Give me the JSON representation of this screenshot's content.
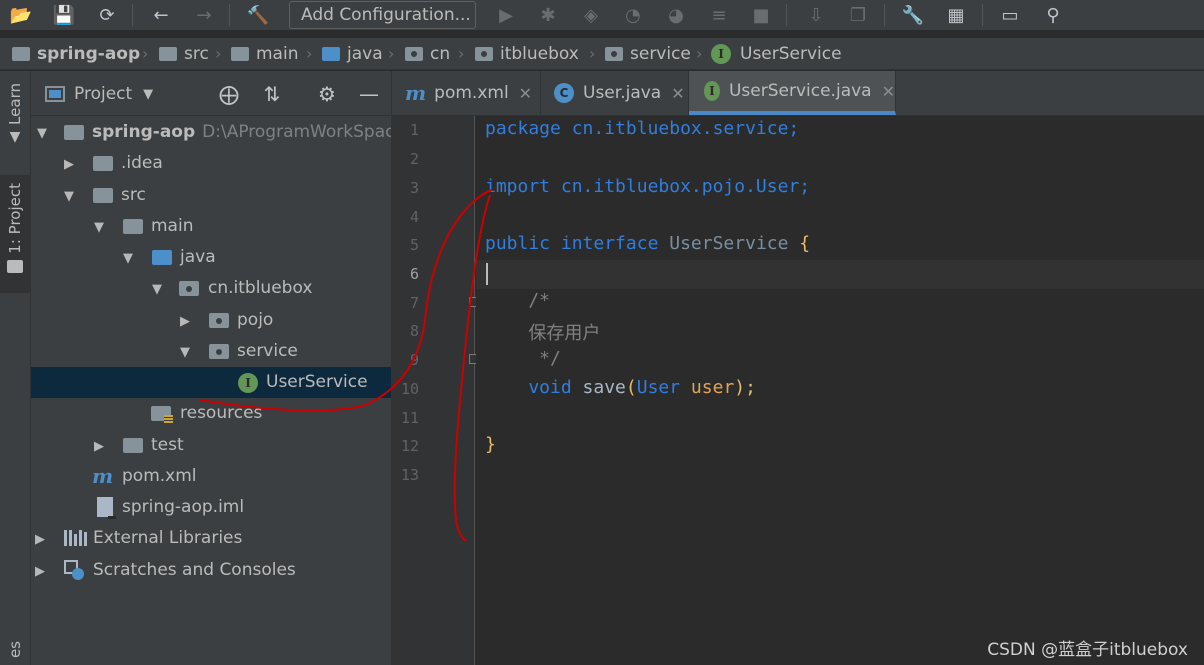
{
  "toolbar": {
    "run_config": "Add Configuration..."
  },
  "breadcrumb": [
    "spring-aop",
    "src",
    "main",
    "java",
    "cn",
    "itbluebox",
    "service",
    "UserService"
  ],
  "stripe": {
    "learn": "Learn",
    "project": "1: Project",
    "bottom": "es"
  },
  "project_panel": {
    "title": "Project"
  },
  "tree": {
    "root": "spring-aop",
    "root_path": "D:\\AProgramWorkSpace",
    "idea": ".idea",
    "src": "src",
    "main": "main",
    "java": "java",
    "package": "cn.itbluebox",
    "pojo": "pojo",
    "service": "service",
    "userservice": "UserService",
    "resources": "resources",
    "test": "test",
    "pom": "pom.xml",
    "iml": "spring-aop.iml",
    "ext_libs": "External Libraries",
    "scratches": "Scratches and Consoles"
  },
  "tabs": [
    {
      "label": "pom.xml",
      "icon": "maven-icon"
    },
    {
      "label": "User.java",
      "icon": "class-icon"
    },
    {
      "label": "UserService.java",
      "icon": "interface-icon",
      "active": true
    }
  ],
  "editor": {
    "current_line": 6,
    "line_numbers": [
      "1",
      "2",
      "3",
      "4",
      "5",
      "6",
      "7",
      "8",
      "9",
      "10",
      "11",
      "12",
      "13"
    ],
    "code": {
      "l1_kw": "package",
      "l1_rest": " cn.itbluebox.service;",
      "l3_kw": "import",
      "l3_rest": " cn.itbluebox.pojo.User;",
      "l5_kw1": "public",
      "l5_kw2": " interface",
      "l5_name": " UserService",
      "l5_brace": " {",
      "l7": "    /*",
      "l8": "    保存用户",
      "l9": "     */",
      "l10_type": "    void",
      "l10_meth": " save",
      "l10_p1": "(",
      "l10_ptype": "User",
      "l10_pname": " user",
      "l10_p2": ");",
      "l12": "}"
    }
  },
  "watermark": "CSDN @蓝盒子itbluebox",
  "colors": {
    "keyword": "#2f7ee0",
    "brace": "#e8bf6a",
    "comment": "#808080",
    "annotation_stroke": "#cc0000",
    "selection": "#0d293e"
  }
}
